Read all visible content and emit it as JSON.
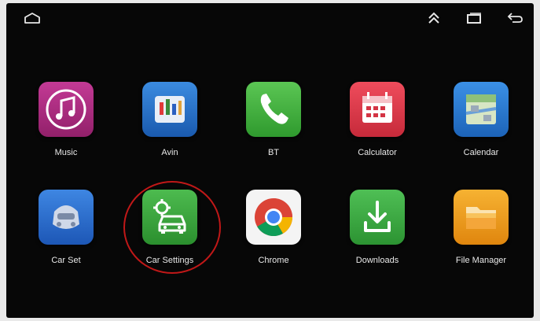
{
  "statusbar": {
    "home_icon": "home-outline-icon",
    "collapse_icon": "double-chevron-up-icon",
    "recents_icon": "recents-icon",
    "back_icon": "back-arrow-icon"
  },
  "apps": [
    {
      "label": "Music",
      "icon": "music-note-icon",
      "color": "#b3287f"
    },
    {
      "label": "Avin",
      "icon": "avin-icon",
      "color": "#1e6fc9"
    },
    {
      "label": "BT",
      "icon": "phone-icon",
      "color": "#3fae3a"
    },
    {
      "label": "Calculator",
      "icon": "calendar-grid-icon",
      "color": "#e03a4a"
    },
    {
      "label": "Calendar",
      "icon": "calendar-map-icon",
      "color": "#2c7fd6"
    },
    {
      "label": "Car Set",
      "icon": "car-set-icon",
      "color": "#2f6fd0"
    },
    {
      "label": "Car Settings",
      "icon": "car-gear-icon",
      "color": "#3aa63e"
    },
    {
      "label": "Chrome",
      "icon": "chrome-icon",
      "color": "#ffffff"
    },
    {
      "label": "Downloads",
      "icon": "download-icon",
      "color": "#3aa63e"
    },
    {
      "label": "File Manager",
      "icon": "folder-icon",
      "color": "#f0a21e"
    }
  ],
  "highlight": {
    "target": "Car Settings",
    "color": "#c01818"
  }
}
